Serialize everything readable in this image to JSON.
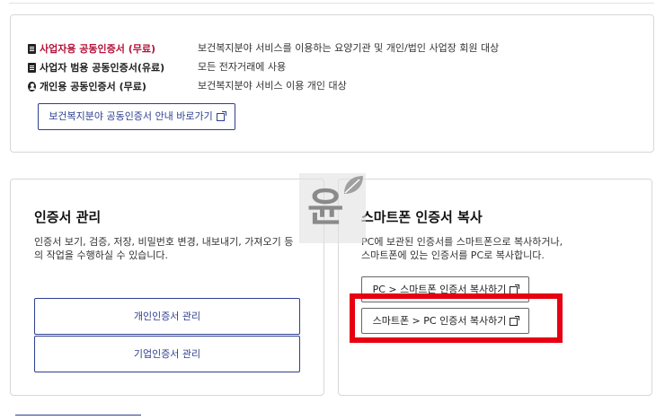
{
  "cert_info": {
    "rows": [
      {
        "name": "사업자용 공동인증서 (무료)",
        "desc": "보건복지분야 서비스를 이용하는 요양기관 및 개인/법인 사업장 회원 대상",
        "icon": "document-icon",
        "color": "#b5123a"
      },
      {
        "name": "사업자 범용 공동인증서(유료)",
        "desc": "모든 전자거래에 사용",
        "icon": "document-icon",
        "color": "#222222"
      },
      {
        "name": "개인용 공동인증서 (무료)",
        "desc": "보건복지분야 서비스 이용 개인 대상",
        "icon": "user-circle-icon",
        "color": "#222222"
      }
    ],
    "guide_button": "보건복지분야 공동인증서 안내 바로가기"
  },
  "manage": {
    "title": "인증서 관리",
    "desc_line1": "인증서 보기, 검증, 저장, 비밀번호 변경, 내보내기, 가져오기 등",
    "desc_line2": "의 작업을 수행하실 수 있습니다.",
    "personal_button": "개인인증서 관리",
    "corporate_button": "기업인증서 관리"
  },
  "copy": {
    "title": "스마트폰 인증서 복사",
    "desc_line1": "PC에 보관된 인증서를 스마트폰으로 복사하거나,",
    "desc_line2": "스마트폰에 있는 인증서를 PC로 복사합니다.",
    "pc_to_phone": "PC > 스마트폰 인증서 복사하기",
    "phone_to_pc": "스마트폰 > PC 인증서 복사하기"
  },
  "watermark": {
    "char": "윤"
  },
  "colors": {
    "accent": "#2e3f8f",
    "highlight": "#e60012",
    "red_text": "#b5123a"
  }
}
